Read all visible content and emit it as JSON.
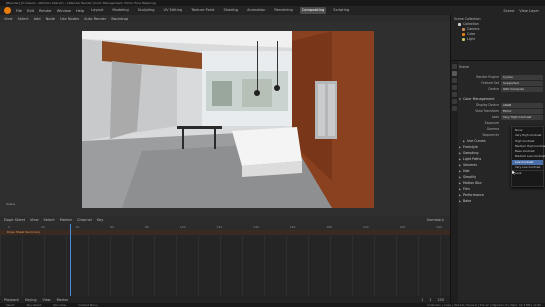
{
  "window": {
    "title": "[Blender] [C:\\Users\\...\\Kitchen Interior\\...] Blender Render (Color Management, Filmic Tone Mapping)"
  },
  "topbar": {
    "menus": [
      "File",
      "Edit",
      "Render",
      "Window",
      "Help"
    ],
    "tabs": [
      "Layout",
      "Modeling",
      "Sculpting",
      "UV Editing",
      "Texture Paint",
      "Shading",
      "Animation",
      "Rendering",
      "Compositing",
      "Scripting"
    ],
    "active_tab": "Compositing",
    "scene": "Scene",
    "view_layer": "View Layer"
  },
  "viewport_header": {
    "items": [
      "View",
      "Select",
      "Add",
      "Node",
      "Use Nodes",
      "Auto Render",
      "Backdrop"
    ]
  },
  "viewport": {
    "label": "Scene"
  },
  "timeline_header": {
    "items": [
      "Dope Sheet",
      "View",
      "Select",
      "Marker",
      "Channel",
      "Key"
    ],
    "mode": "Summary"
  },
  "timeline": {
    "track": "Dope Sheet Summary",
    "frames": [
      "0",
      "20",
      "40",
      "60",
      "80",
      "100",
      "120",
      "140",
      "160",
      "180",
      "200",
      "220",
      "240"
    ]
  },
  "playback_bar": {
    "items": [
      "Playback",
      "Keying",
      "View",
      "Marker"
    ],
    "start": "1",
    "end": "250",
    "current": "1"
  },
  "statusbar": {
    "items": [
      "Select",
      "Box Select",
      "Pan View",
      "Context Menu"
    ],
    "right": "Collection | Cube | Verts:8 | Faces:6 | Tris:12 | Objects:1/3 | Mem: 42.3 MB | v2.80"
  },
  "outliner": {
    "title": "Scene Collection",
    "items": [
      {
        "name": "Collection",
        "color": "#cfcfcf"
      },
      {
        "name": "Camera",
        "color": "#c98a5a"
      },
      {
        "name": "Cube",
        "color": "#e87d0d"
      },
      {
        "name": "Light",
        "color": "#c9c36a"
      }
    ]
  },
  "properties": {
    "header": "Scene",
    "rows": [
      {
        "label": "Render Engine",
        "value": "Cycles"
      },
      {
        "label": "Feature Set",
        "value": "Supported"
      },
      {
        "label": "Device",
        "value": "GPU Compute"
      }
    ],
    "color_management": "Color Management",
    "cm_rows": [
      {
        "label": "Display Device",
        "value": "sRGB"
      },
      {
        "label": "View Transform",
        "value": "Filmic"
      },
      {
        "label": "Look",
        "value": "Very High Contrast"
      },
      {
        "label": "Exposure",
        "value": ""
      },
      {
        "label": "Gamma",
        "value": ""
      },
      {
        "label": "Sequencer",
        "value": ""
      }
    ],
    "sections": [
      "Use Curves",
      "Freestyle",
      "Sampling",
      "Light Paths",
      "Volumes",
      "Hair",
      "Simplify",
      "Motion Blur",
      "Film",
      "Performance",
      "Bake"
    ]
  },
  "look_dropdown": {
    "options": [
      "None",
      "Very High Contrast",
      "High Contrast",
      "Medium High Contrast",
      "Base Contrast",
      "Medium Low Contrast",
      "Low Contrast",
      "Very Low Contrast",
      "Look"
    ],
    "selected": "Low Contrast"
  },
  "colors": {
    "accent": "#e87d0d",
    "selection": "#4b6fa8",
    "playhead": "#4b8ad8"
  }
}
